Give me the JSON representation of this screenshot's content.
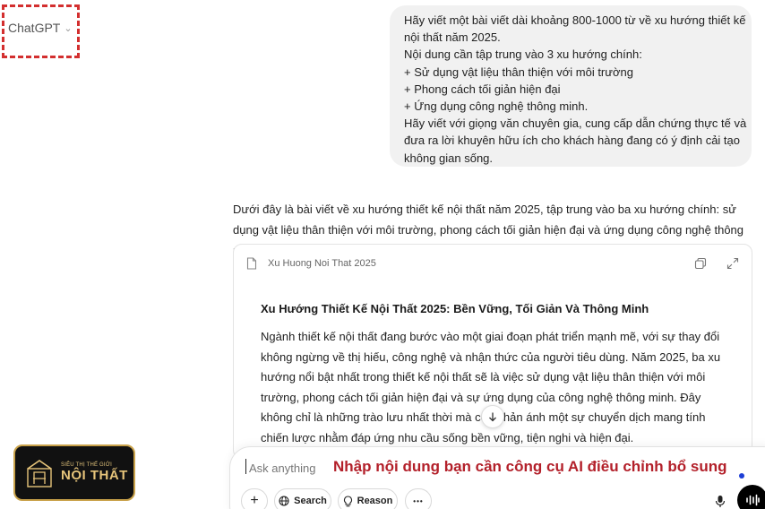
{
  "model_picker": {
    "label": "ChatGPT",
    "chevron_icon": "chevron-down-icon"
  },
  "user_message": {
    "lines": [
      "Hãy viết một bài viết dài khoảng 800-1000 từ về xu hướng thiết kế",
      "nội thất năm 2025.",
      "Nội dung cần tập trung vào 3 xu hướng chính:",
      "+ Sử dụng vật liệu thân thiện với môi trường",
      "+ Phong cách tối giản hiện đại",
      "+ Ứng dụng công nghệ thông minh.",
      "Hãy viết với giọng văn chuyên gia, cung cấp dẫn chứng thực tế và",
      "đưa ra lời khuyên hữu ích cho khách hàng đang có ý định cải tạo",
      "không gian sống."
    ]
  },
  "assistant": {
    "intro": "Dưới đây là bài viết về xu hướng thiết kế nội thất năm 2025, tập trung vào ba xu hướng chính: sử dụng vật liệu thân thiện với môi trường, phong cách tối giản hiện đại và ứng dụng công nghệ thông minh.",
    "document": {
      "title": "Xu Huong Noi That 2025",
      "heading": "Xu Hướng Thiết Kế Nội Thất 2025: Bền Vững, Tối Giản Và Thông Minh",
      "paragraph": "Ngành thiết kế nội thất đang bước vào một giai đoạn phát triển mạnh mẽ, với sự thay đổi không ngừng về thị hiếu, công nghệ và nhận thức của người tiêu dùng. Năm 2025, ba xu hướng nổi bật nhất trong thiết kế nội thất sẽ là việc sử dụng vật liệu thân thiện với môi trường, phong cách tối giản hiện đại và sự ứng dụng của công nghệ thông minh. Đây không chỉ là những trào lưu nhất thời mà còn phản ánh một sự chuyển dịch mang tính chiến lược nhằm đáp ứng nhu cầu sống bền vững, tiện nghi và hiện đại.",
      "icons": [
        "document-icon",
        "copy-icon",
        "expand-icon"
      ]
    }
  },
  "composer": {
    "placeholder": "Ask anything",
    "annotation": "Nhập nội dung bạn cần công cụ AI điều chỉnh bổ sung",
    "buttons": {
      "plus": "+",
      "search": "Search",
      "reason": "Reason",
      "more": "•••"
    }
  },
  "logo": {
    "tagline": "SIÊU THỊ THẾ GIỚI",
    "name": "NỘI THẤT"
  },
  "colors": {
    "annotation": "#b3202a",
    "highlight_border": "#d32f2f",
    "logo_gold": "#e6c47a"
  }
}
